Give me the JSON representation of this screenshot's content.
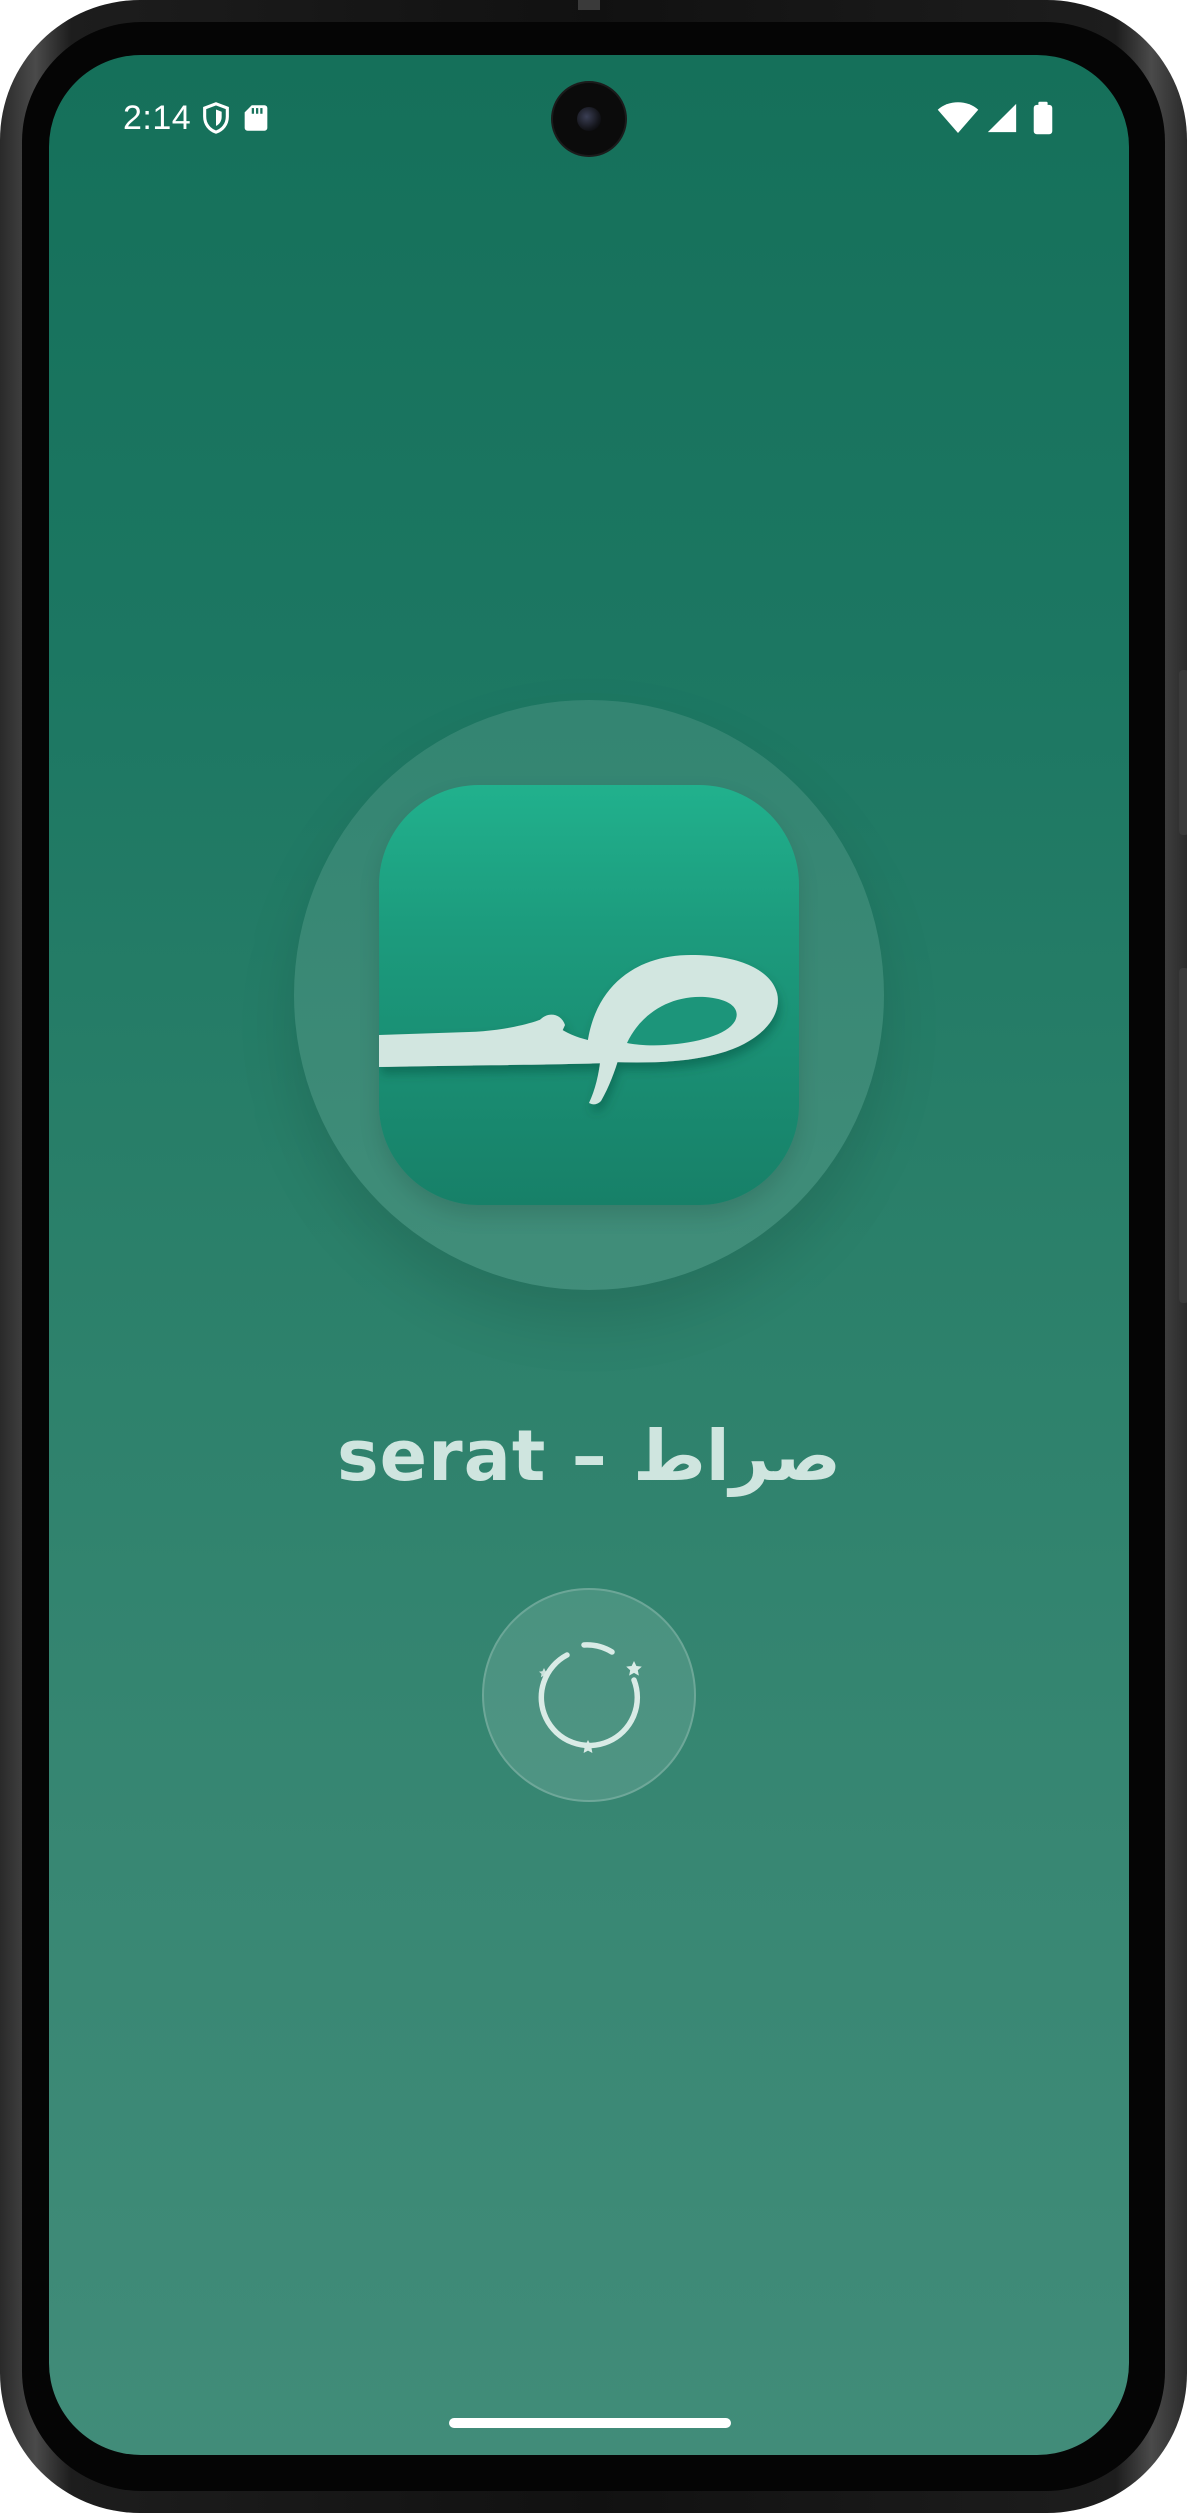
{
  "status_bar": {
    "time": "2:14",
    "left_icons": [
      "shield-icon",
      "sd-card-icon"
    ],
    "right_icons": [
      "wifi-icon",
      "cell-signal-icon",
      "battery-icon"
    ]
  },
  "splash": {
    "app_title": "serat – صراط",
    "logo_glyph_icon": "sad-letter-logo-icon",
    "loader_icon": "loading-spinner-icon"
  },
  "colors": {
    "background_top": "#15705a",
    "background_bottom": "#418c79",
    "logo_tile_top": "#21b18d",
    "logo_tile_bottom": "#178068",
    "title_color": "#cfe5df"
  }
}
